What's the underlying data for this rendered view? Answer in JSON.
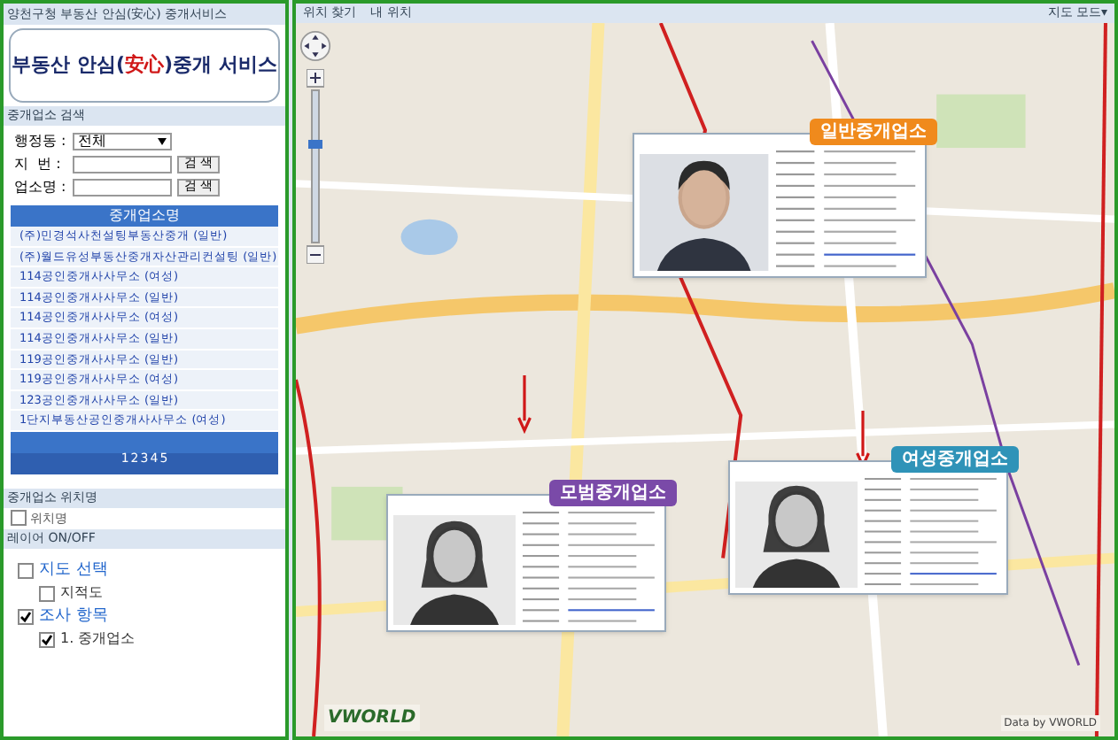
{
  "sidebar": {
    "title": "양천구청 부동산 안심(安心) 중개서비스",
    "logo": {
      "before": "부동산 안심(",
      "accent": "安心",
      "after": ")중개 서비스"
    },
    "search": {
      "header": "중개업소 검색",
      "fields": [
        {
          "kind": "select",
          "label": "행정동 :",
          "value": "전체"
        },
        {
          "kind": "input",
          "label": "지  번 :",
          "button": "검 색"
        },
        {
          "kind": "input",
          "label": "업소명 :",
          "button": "검 색"
        }
      ]
    },
    "list": {
      "header": "중개업소명",
      "items": [
        "(주)민경석사천설팅부동산중개 (일반)",
        "(주)월드유성부동산중개자산관리컨설팅 (일반)",
        "114공인중개사사무소 (여성)",
        "114공인중개사사무소 (일반)",
        "114공인중개사사무소 (여성)",
        "114공인중개사사무소 (일반)",
        "119공인중개사사무소 (일반)",
        "119공인중개사사무소 (여성)",
        "123공인중개사사무소 (일반)",
        "1단지부동산공인중개사사무소 (여성)"
      ],
      "pages": [
        "1",
        "2",
        "3",
        "4",
        "5"
      ]
    },
    "location": {
      "header": "중개업소 위치명",
      "checkbox": {
        "label": "위치명",
        "checked": false
      }
    },
    "layers": {
      "header": "레이어 ON/OFF",
      "tree": [
        {
          "label": "지도 선택",
          "checked": false,
          "children": [
            {
              "label": "지적도",
              "checked": false
            }
          ]
        },
        {
          "label": "조사 항목",
          "checked": true,
          "children": [
            {
              "label": "1. 중개업소",
              "checked": true
            }
          ]
        }
      ]
    }
  },
  "map": {
    "toolbar": [
      "위치 찾기",
      "내 위치"
    ],
    "mode": "지도 모드▾",
    "cards": [
      {
        "badge": "일반중개업소",
        "color": "#f08a1c"
      },
      {
        "badge": "모범중개업소",
        "color": "#7a4aa8"
      },
      {
        "badge": "여성중개업소",
        "color": "#2f93b8"
      }
    ],
    "logo": "VWORLD",
    "credit": "Data by VWORLD"
  }
}
